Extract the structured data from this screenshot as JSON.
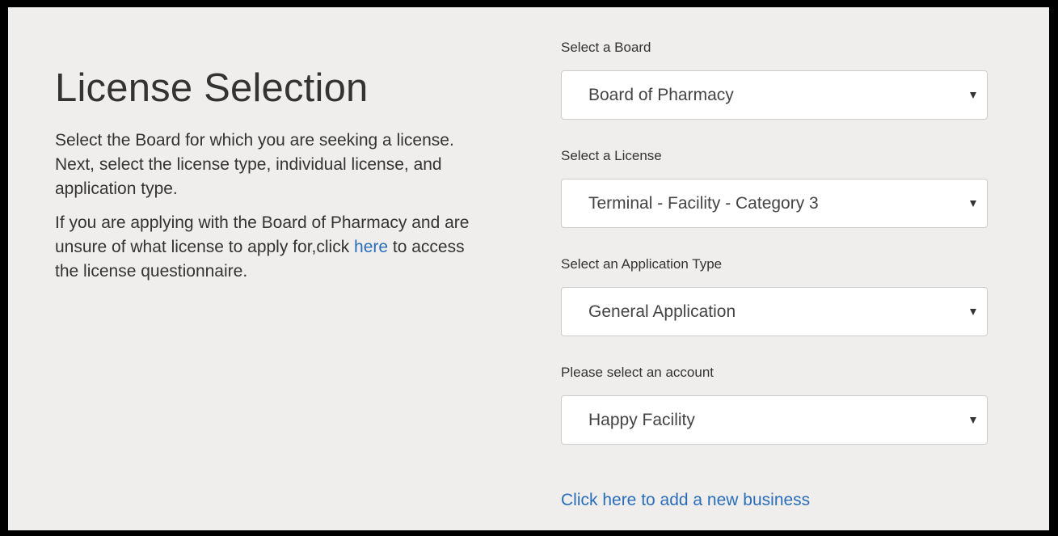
{
  "page": {
    "title": "License Selection",
    "intro": "Select the Board for which you are seeking a license. Next, select the license type, individual license, and application type.",
    "help_prefix": "If you are applying with the Board of Pharmacy and are unsure of what license to apply for,click ",
    "help_link": "here",
    "help_suffix": " to access the license questionnaire."
  },
  "form": {
    "board": {
      "label": "Select a Board",
      "value": "Board of Pharmacy"
    },
    "license": {
      "label": "Select a License",
      "value": "Terminal - Facility - Category 3"
    },
    "application_type": {
      "label": "Select an Application Type",
      "value": "General Application"
    },
    "account": {
      "label": "Please select an account",
      "value": "Happy Facility"
    },
    "add_business_link": "Click here to add a new business"
  },
  "icons": {
    "dropdown": "caret-down-icon"
  },
  "colors": {
    "background": "#efeeec",
    "link": "#2a6ebb",
    "text": "#333333",
    "border": "#000000"
  }
}
